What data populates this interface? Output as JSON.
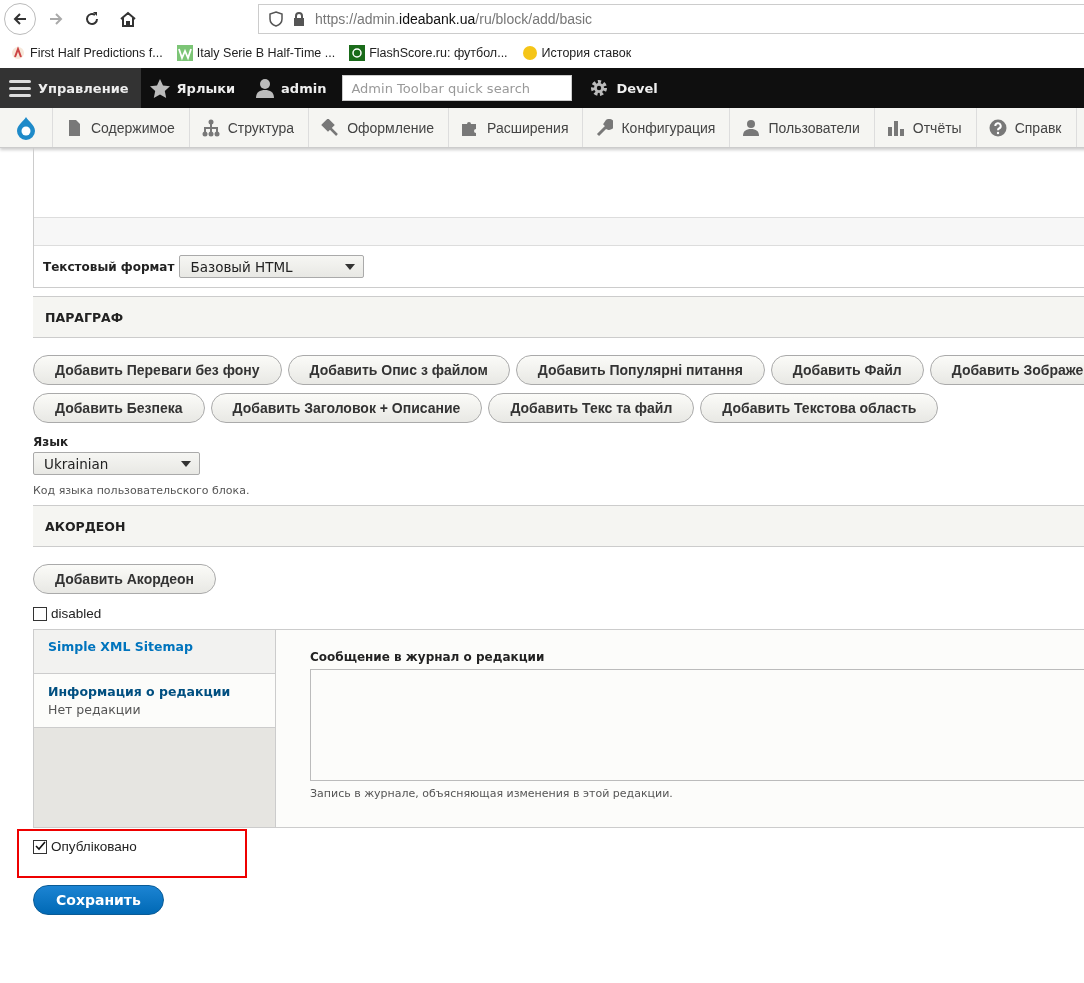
{
  "browser": {
    "url_prefix": "https://admin.",
    "url_domain": "ideabank.ua",
    "url_path": "/ru/block/add/basic"
  },
  "bookmarks": [
    {
      "label": "First Half Predictions f..."
    },
    {
      "label": "Italy Serie B Half-Time ..."
    },
    {
      "label": "FlashScore.ru: футбол..."
    },
    {
      "label": "История ставок"
    }
  ],
  "admin_toolbar": {
    "items": [
      {
        "kind": "menu",
        "label": "Управление",
        "selected": true
      },
      {
        "kind": "star",
        "label": "Ярлыки",
        "selected": false
      },
      {
        "kind": "user",
        "label": "admin",
        "selected": false
      }
    ],
    "search_placeholder": "Admin Toolbar quick search",
    "devel": "Devel"
  },
  "tray": [
    {
      "kind": "page",
      "label": "Содержимое"
    },
    {
      "kind": "tree",
      "label": "Структура"
    },
    {
      "kind": "brush",
      "label": "Оформление"
    },
    {
      "kind": "puzzle",
      "label": "Расширения"
    },
    {
      "kind": "wrench",
      "label": "Конфигурация"
    },
    {
      "kind": "people",
      "label": "Пользователи"
    },
    {
      "kind": "bars",
      "label": "Отчёты"
    },
    {
      "kind": "help",
      "label": "Справк"
    }
  ],
  "text_format": {
    "label": "Текстовый формат",
    "value": "Базовый HTML"
  },
  "paragraph": {
    "title": "ПАРАГРАФ",
    "buttons": [
      [
        "Добавить Переваги без фону",
        "Добавить Опис з файлом",
        "Добавить Популярні питання",
        "Добавить Файл",
        "Добавить Зображе"
      ],
      [
        "Добавить Безпека",
        "Добавить Заголовок + Описание",
        "Добавить Текс та файл",
        "Добавить Текстова область"
      ]
    ]
  },
  "language": {
    "label": "Язык",
    "value": "Ukrainian",
    "help": "Код языка пользовательского блока."
  },
  "accordion": {
    "title": "АКОРДЕОН",
    "button": "Добавить Акордеон"
  },
  "disabled_checkbox": {
    "label": "disabled",
    "checked": false
  },
  "vertical_tabs": [
    {
      "title": "Simple XML Sitemap",
      "selected": false
    },
    {
      "title": "Информация о редакции",
      "summary": "Нет редакции",
      "selected": true
    }
  ],
  "revision_log": {
    "label": "Сообщение в журнал о редакции",
    "help": "Запись в журнале, объясняющая изменения в этой редакции."
  },
  "published_checkbox": {
    "label": "Опубліковано",
    "checked": true
  },
  "save_button": "Сохранить"
}
